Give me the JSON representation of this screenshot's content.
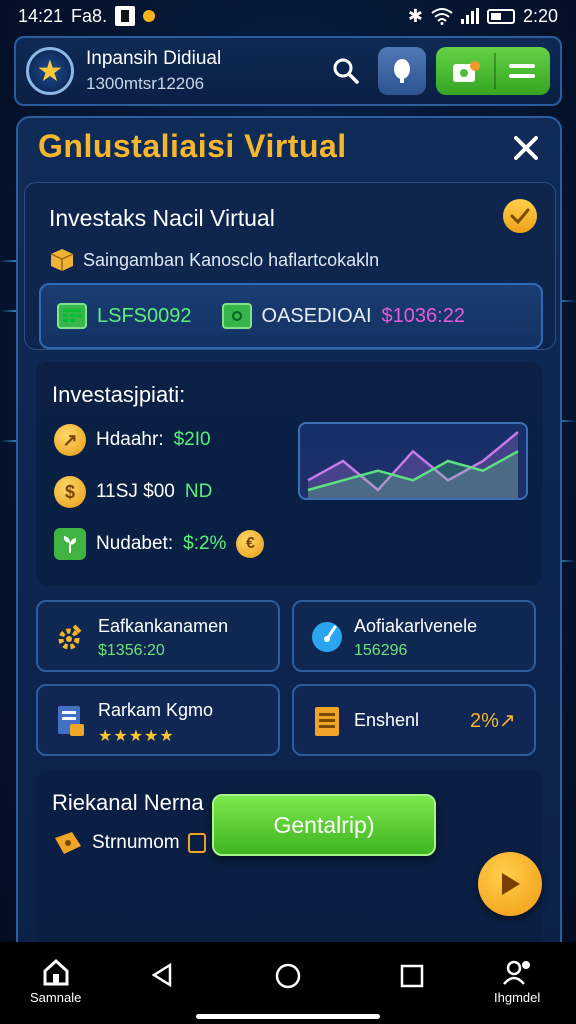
{
  "status_bar": {
    "time": "14:21",
    "carrier": "Fa8.",
    "clock_right": "2:20"
  },
  "header": {
    "title": "Inpansih Didiual",
    "subtitle": "1300mtsr12206"
  },
  "panel": {
    "title": "Gnlustaliaisi Virtual",
    "top_card": {
      "title": "Investaks Nacil Virtual",
      "subtitle": "Saingamban Kanosclo haflartcokakln",
      "code_left": "LSFS0092",
      "code_right_label": "OASEDIOAI",
      "code_right_value": "$1036:22"
    },
    "investasi": {
      "title": "Investasjpiati:",
      "rows": [
        {
          "label": "Hdaahr:",
          "value": "$2I0"
        },
        {
          "label": "11SJ $00",
          "value": "ND"
        },
        {
          "label": "Nudabet:",
          "value": "$:2%"
        }
      ],
      "chart": {
        "type": "line",
        "series": [
          {
            "values": [
              3,
              5,
              2,
              6,
              3,
              5,
              8
            ]
          },
          {
            "values": [
              2,
              3,
              4,
              3,
              5,
              4,
              6
            ]
          }
        ]
      }
    },
    "tiles": [
      {
        "name": "Eafkankanamen",
        "value": "$1356:20",
        "icon": "gear-icon"
      },
      {
        "name": "Aofiakarlvenele",
        "value": "156296",
        "icon": "gauge-icon"
      },
      {
        "name": "Rarkam Kgmo",
        "value": "★★★★★",
        "icon": "document-icon"
      },
      {
        "name": "Enshenl",
        "value": "2%↗",
        "icon": "clipboard-icon"
      }
    ],
    "rekanal": {
      "title": "Riekanal Nerna",
      "subtitle": "Strnumom",
      "cta_label": "Gentalrip)"
    }
  },
  "navbar": {
    "home_label": "Samnale",
    "profile_label": "Ihgmdel"
  },
  "colors": {
    "accent_gold": "#f6b72d",
    "green": "#5cf07a",
    "panel": "#0f2b58"
  }
}
